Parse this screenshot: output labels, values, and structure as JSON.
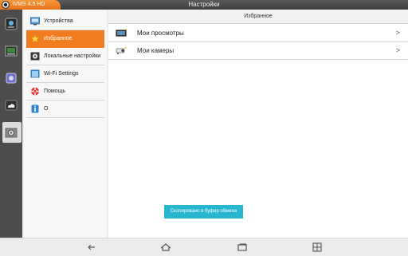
{
  "titlebar": {
    "app_name": "iVMS 4.5 HD",
    "window_title": "Настройки",
    "accent_color": "#f07c1f"
  },
  "rail": {
    "items": [
      {
        "icon": "live-view-icon"
      },
      {
        "icon": "playback-icon"
      },
      {
        "icon": "picture-gallery-icon"
      },
      {
        "icon": "cloud-icon"
      },
      {
        "icon": "settings-icon",
        "active": true
      }
    ]
  },
  "menu": {
    "items": [
      {
        "label": "Устройства",
        "icon": "devices-icon"
      },
      {
        "label": "Избранное",
        "icon": "star-icon",
        "active": true
      },
      {
        "label": "Локальные настройки",
        "icon": "local-settings-icon"
      },
      {
        "label": "Wi-Fi Settings",
        "icon": "wifi-settings-icon"
      },
      {
        "label": "Помощь",
        "icon": "help-icon"
      },
      {
        "label": "О",
        "icon": "info-icon"
      }
    ]
  },
  "content": {
    "header": "Избранное",
    "rows": [
      {
        "label": "Мои просмотры",
        "icon": "my-views-icon",
        "chevron": ">"
      },
      {
        "label": "Мои камеры",
        "icon": "my-cameras-icon",
        "chevron": ">"
      }
    ]
  },
  "toast": {
    "text": "Скопировано в буфер обмена",
    "color": "#27b5cf"
  },
  "navbar": {
    "buttons": [
      {
        "icon": "back-icon"
      },
      {
        "icon": "home-icon"
      },
      {
        "icon": "recent-apps-icon"
      },
      {
        "icon": "screenshot-icon"
      }
    ]
  }
}
